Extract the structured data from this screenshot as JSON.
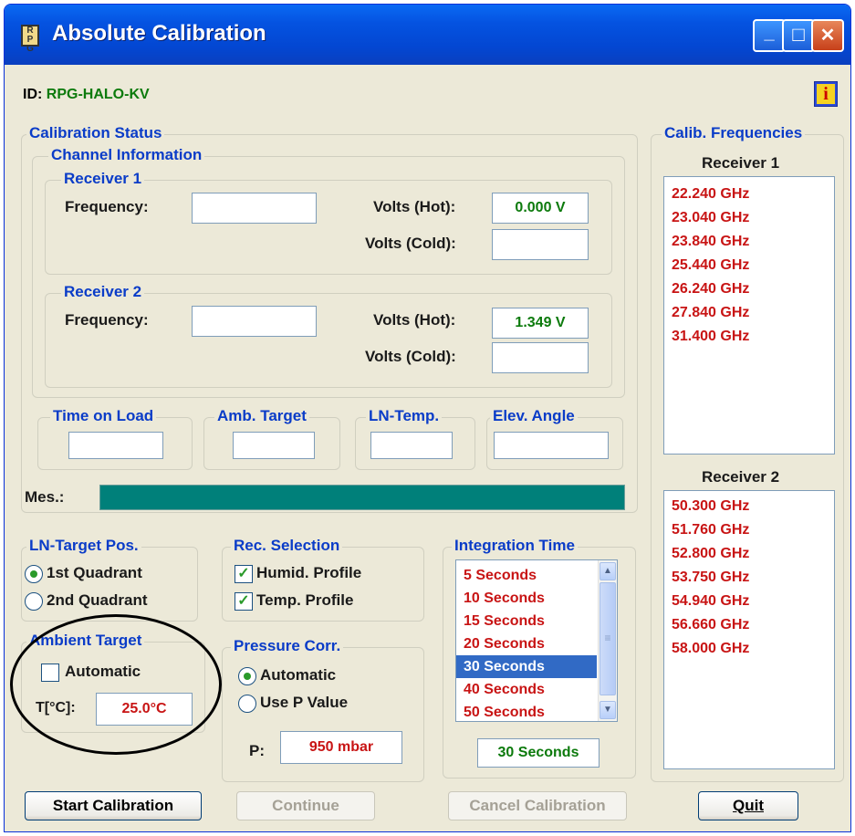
{
  "window": {
    "title": "Absolute Calibration",
    "minimize_glyph": "_",
    "maximize_glyph": "□",
    "close_glyph": "✕"
  },
  "app_icon_text": "R P G",
  "device": {
    "id_label": "ID:",
    "id_value": "RPG-HALO-KV"
  },
  "info_icon_glyph": "i",
  "calibration_status": {
    "title": "Calibration Status",
    "channel_info": {
      "title": "Channel Information",
      "receiver1": {
        "title": "Receiver 1",
        "frequency_label": "Frequency:",
        "frequency_value": "",
        "volts_hot_label": "Volts (Hot):",
        "volts_hot_value": "0.000 V",
        "volts_cold_label": "Volts (Cold):",
        "volts_cold_value": ""
      },
      "receiver2": {
        "title": "Receiver 2",
        "frequency_label": "Frequency:",
        "frequency_value": "",
        "volts_hot_label": "Volts (Hot):",
        "volts_hot_value": "1.349 V",
        "volts_cold_label": "Volts (Cold):",
        "volts_cold_value": ""
      }
    },
    "time_on_load": {
      "title": "Time on Load",
      "value": ""
    },
    "amb_target": {
      "title": "Amb. Target",
      "value": ""
    },
    "ln_temp": {
      "title": "LN-Temp.",
      "value": ""
    },
    "elev_angle": {
      "title": "Elev. Angle",
      "value": ""
    },
    "mes_label": "Mes.:"
  },
  "ln_target_pos": {
    "title": "LN-Target Pos.",
    "options": [
      "1st Quadrant",
      "2nd Quadrant"
    ],
    "selected": 0
  },
  "rec_selection": {
    "title": "Rec. Selection",
    "options": [
      "Humid. Profile",
      "Temp. Profile"
    ]
  },
  "integration_time": {
    "title": "Integration Time",
    "items": [
      "5 Seconds",
      "10 Seconds",
      "15 Seconds",
      "20 Seconds",
      "30 Seconds",
      "40 Seconds",
      "50 Seconds"
    ],
    "selected": "30 Seconds",
    "display": "30 Seconds",
    "scroll_up_glyph": "▲",
    "scroll_down_glyph": "▼",
    "grip_glyph": "≡"
  },
  "ambient_target": {
    "title": "Ambient Target",
    "automatic_label": "Automatic",
    "temp_label": "T[°C]:",
    "temp_value": "25.0°C"
  },
  "pressure_corr": {
    "title": "Pressure Corr.",
    "options": [
      "Automatic",
      "Use P Value"
    ],
    "selected": 0,
    "p_label": "P:",
    "p_value": "950 mbar"
  },
  "calib_frequencies": {
    "title": "Calib. Frequencies",
    "receiver1": {
      "title": "Receiver 1",
      "items": [
        "22.240 GHz",
        "23.040 GHz",
        "23.840 GHz",
        "25.440 GHz",
        "26.240 GHz",
        "27.840 GHz",
        "31.400 GHz"
      ]
    },
    "receiver2": {
      "title": "Receiver 2",
      "items": [
        "50.300 GHz",
        "51.760 GHz",
        "52.800 GHz",
        "53.750 GHz",
        "54.940 GHz",
        "56.660 GHz",
        "58.000 GHz"
      ]
    }
  },
  "buttons": {
    "start": "Start Calibration",
    "continue": "Continue",
    "cancel": "Cancel Calibration",
    "quit": "Quit"
  },
  "colors": {
    "titlebar": "#0553e1",
    "mes_bar": "#00807a",
    "value_green": "#0c7a0c",
    "value_red": "#c81414",
    "label_blue": "#0a3cc8"
  }
}
